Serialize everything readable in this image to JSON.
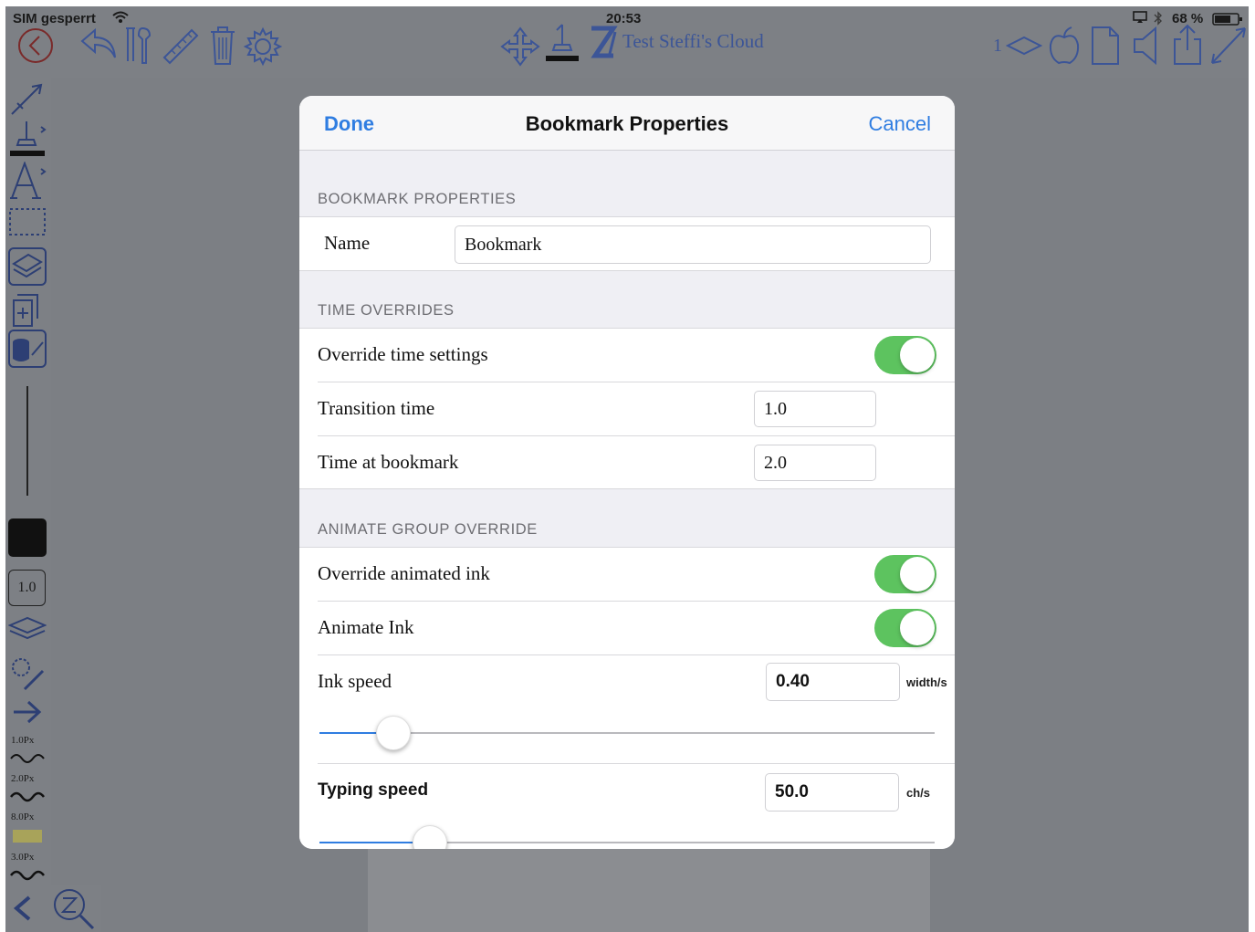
{
  "status_bar": {
    "carrier": "SIM gesperrt",
    "time": "20:53",
    "battery": "68 %"
  },
  "toolbar": {
    "document_title": "Test Steffi's Cloud",
    "page_indicator": "1"
  },
  "sidebar": {
    "pen_width": "1.0",
    "pen_presets": [
      "1.0Px",
      "2.0Px",
      "8.0Px",
      "3.0Px"
    ]
  },
  "modal": {
    "title": "Bookmark Properties",
    "done_label": "Done",
    "cancel_label": "Cancel",
    "sections": {
      "bookmark": {
        "header": "BOOKMARK PROPERTIES",
        "name_label": "Name",
        "name_value": "Bookmark"
      },
      "time": {
        "header": "TIME OVERRIDES",
        "override_label": "Override time settings",
        "override_on": true,
        "transition_label": "Transition time",
        "transition_value": "1.0",
        "time_at_label": "Time at bookmark",
        "time_at_value": "2.0"
      },
      "animate": {
        "header": "ANIMATE GROUP OVERRIDE",
        "override_label": "Override animated ink",
        "override_on": true,
        "animate_label": "Animate Ink",
        "animate_on": true,
        "ink_speed_label": "Ink speed",
        "ink_speed_value": "0.40",
        "ink_speed_unit": "width/s",
        "ink_speed_slider": 0.12,
        "typing_speed_label": "Typing speed",
        "typing_speed_value": "50.0",
        "typing_speed_unit": "ch/s",
        "typing_speed_slider": 0.18
      }
    }
  },
  "colors": {
    "accent": "#2f7de1",
    "toggle_on": "#5dc35f",
    "toolbar_icon": "#3c5597"
  }
}
